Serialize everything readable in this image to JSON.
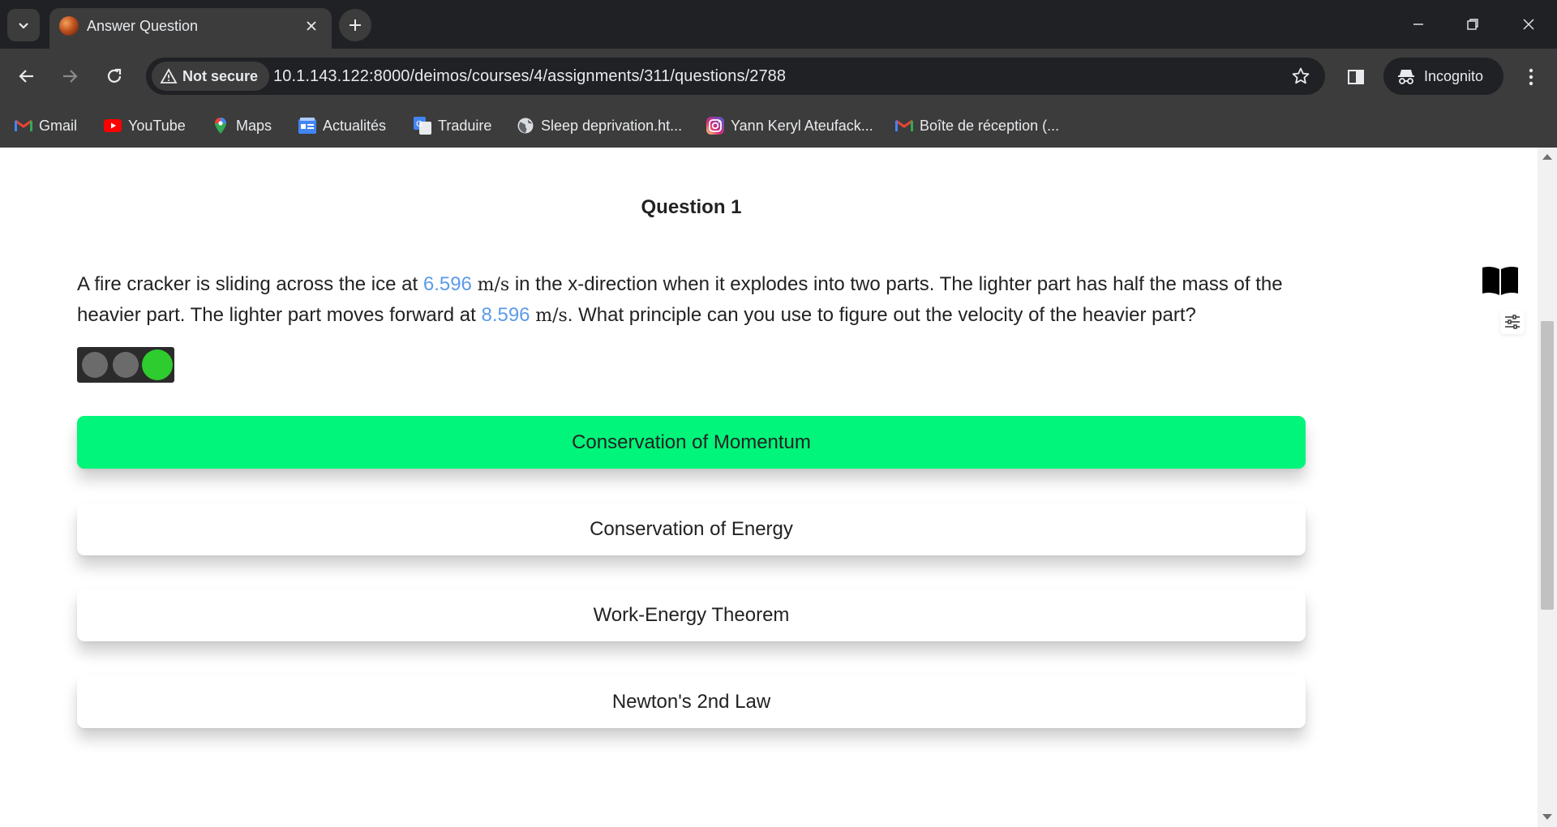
{
  "browser": {
    "tab": {
      "title": "Answer Question"
    },
    "address": {
      "security_label": "Not secure",
      "url": "10.1.143.122:8000/deimos/courses/4/assignments/311/questions/2788"
    },
    "incognito_label": "Incognito",
    "bookmarks": [
      {
        "label": "Gmail",
        "icon": "gmail-icon"
      },
      {
        "label": "YouTube",
        "icon": "youtube-icon"
      },
      {
        "label": "Maps",
        "icon": "maps-icon"
      },
      {
        "label": "Actualités",
        "icon": "news-icon"
      },
      {
        "label": "Traduire",
        "icon": "translate-icon"
      },
      {
        "label": "Sleep deprivation.ht...",
        "icon": "globe-icon"
      },
      {
        "label": "Yann Keryl Ateufack...",
        "icon": "instagram-icon"
      },
      {
        "label": "Boîte de réception (...",
        "icon": "gmail-icon"
      }
    ]
  },
  "question": {
    "title": "Question 1",
    "text_parts": {
      "p1": "A fire cracker is sliding across the ice at ",
      "v1": "6.596",
      "u1": "m/s",
      "p2": " in the x-direction when it explodes into two parts. The lighter part has half the mass of the heavier part. The lighter part moves forward at ",
      "v2": "8.596",
      "u2": "m/s",
      "p3": ". What principle can you use to figure out the velocity of the heavier part?"
    },
    "status_lights": [
      "off",
      "off",
      "green"
    ],
    "options": [
      {
        "label": "Conservation of Momentum",
        "selected": true
      },
      {
        "label": "Conservation of Energy",
        "selected": false
      },
      {
        "label": "Work-Energy Theorem",
        "selected": false
      },
      {
        "label": "Newton's 2nd Law",
        "selected": false
      }
    ]
  },
  "colors": {
    "selected_option": "#00f57a",
    "value_highlight": "#5b9bea",
    "light_green": "#2ecc2e",
    "light_off": "#6b6b6b"
  }
}
